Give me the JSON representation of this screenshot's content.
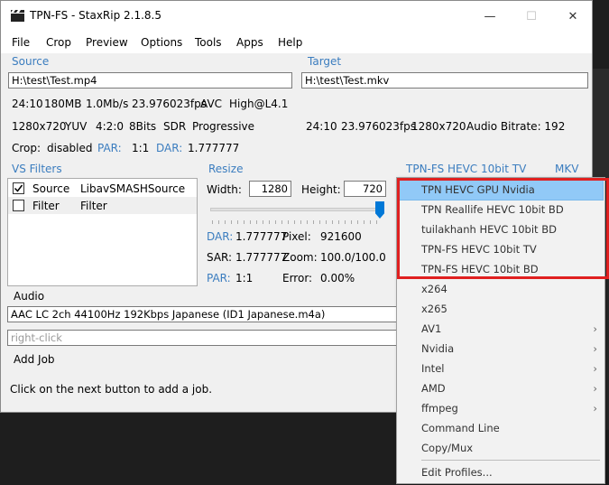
{
  "window": {
    "title": "TPN-FS - StaxRip 2.1.8.5",
    "controls": [
      "—",
      "☐",
      "✕"
    ]
  },
  "menu": [
    "File",
    "Crop",
    "Preview",
    "Options",
    "Tools",
    "Apps",
    "Help"
  ],
  "source": {
    "label": "Source",
    "path": "H:\\test\\Test.mp4",
    "info1": [
      "24:10",
      "180MB",
      "1.0Mb/s",
      "23.976023fps",
      "AVC",
      "High@L4.1"
    ],
    "info2": [
      "1280x720",
      "YUV",
      "4:2:0",
      "8Bits",
      "SDR",
      "Progressive"
    ],
    "crop_label": "Crop:",
    "crop_value": "disabled",
    "par_label": "PAR:",
    "par_value": "1:1",
    "dar_label": "DAR:",
    "dar_value": "1.777777"
  },
  "target": {
    "label": "Target",
    "path": "H:\\test\\Test.mkv",
    "info": [
      "24:10",
      "23.976023fps",
      "1280x720",
      "Audio Bitrate: 192"
    ]
  },
  "filters": {
    "label": "VS Filters",
    "rows": [
      {
        "checked": true,
        "name": "Source",
        "value": "LibavSMASHSource"
      },
      {
        "checked": false,
        "name": "Filter",
        "value": "Filter"
      }
    ]
  },
  "resize": {
    "label": "Resize",
    "width_label": "Width:",
    "width_value": "1280",
    "height_label": "Height:",
    "height_value": "720",
    "dar_label": "DAR:",
    "dar_value": "1.777777",
    "pixel_label": "Pixel:",
    "pixel_value": "921600",
    "sar_label": "SAR:",
    "sar_value": "1.777777",
    "zoom_label": "Zoom:",
    "zoom_value": "100.0/100.0",
    "par_label": "PAR:",
    "par_value": "1:1",
    "error_label": "Error:",
    "error_value": "0.00%"
  },
  "encoder": {
    "profile_label": "TPN-FS HEVC 10bit TV",
    "container_label": "MKV"
  },
  "audio": {
    "label": "Audio",
    "track": "AAC LC 2ch 44100Hz 192Kbps Japanese (ID1 Japanese.m4a)",
    "placeholder": "right-click"
  },
  "job": {
    "label": "Add Job",
    "hint": "Click on the next button to add a job."
  },
  "popup": {
    "items": [
      {
        "label": "TPN HEVC GPU Nvidia",
        "highlighted": true,
        "submenu": false
      },
      {
        "label": "TPN Reallife HEVC 10bit BD",
        "highlighted": false,
        "submenu": false
      },
      {
        "label": "tuilakhanh HEVC 10bit BD",
        "highlighted": false,
        "submenu": false
      },
      {
        "label": "TPN-FS HEVC 10bit TV",
        "highlighted": false,
        "submenu": false
      },
      {
        "label": "TPN-FS HEVC 10bit BD",
        "highlighted": false,
        "submenu": false
      },
      {
        "label": "x264",
        "highlighted": false,
        "submenu": false
      },
      {
        "label": "x265",
        "highlighted": false,
        "submenu": false
      },
      {
        "label": "AV1",
        "highlighted": false,
        "submenu": true
      },
      {
        "label": "Nvidia",
        "highlighted": false,
        "submenu": true
      },
      {
        "label": "Intel",
        "highlighted": false,
        "submenu": true
      },
      {
        "label": "AMD",
        "highlighted": false,
        "submenu": true
      },
      {
        "label": "ffmpeg",
        "highlighted": false,
        "submenu": true
      },
      {
        "label": "Command Line",
        "highlighted": false,
        "submenu": false
      },
      {
        "label": "Copy/Mux",
        "highlighted": false,
        "submenu": false
      },
      {
        "label": "Edit Profiles...",
        "highlighted": false,
        "submenu": false
      }
    ],
    "submenu_arrow": "›"
  },
  "colors": {
    "accent_blue": "#3b7dbf",
    "highlight": "#91c9f7",
    "annotation_red": "#e02020"
  }
}
